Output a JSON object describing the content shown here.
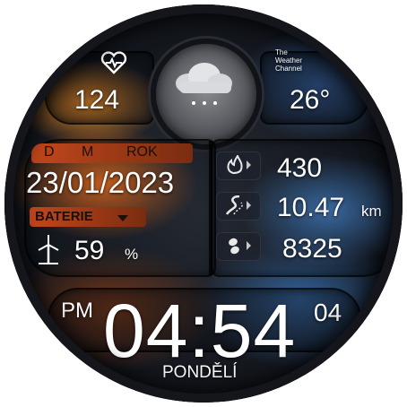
{
  "top": {
    "heart_value": "124",
    "temperature": "26°",
    "weather_channel_line1": "The",
    "weather_channel_line2": "Weather",
    "weather_channel_line3": "Channel"
  },
  "date_panel": {
    "day_label": "D",
    "month_label": "M",
    "year_label": "ROK",
    "date": "23/01/2023",
    "battery_label": "BATERIE",
    "battery_value": "59",
    "battery_unit": "%"
  },
  "stats": {
    "calories": "430",
    "distance": "10.47",
    "distance_unit": "km",
    "steps": "8325"
  },
  "clock": {
    "ampm": "PM",
    "time": "04:54",
    "seconds": "04",
    "weekday": "PONDĚLÍ"
  },
  "icons": {
    "heart": "heart-rate-icon",
    "weather": "cloud-icon",
    "battery": "wind-turbine-icon",
    "calories": "flame-icon",
    "distance": "road-icon",
    "steps": "footsteps-icon"
  }
}
